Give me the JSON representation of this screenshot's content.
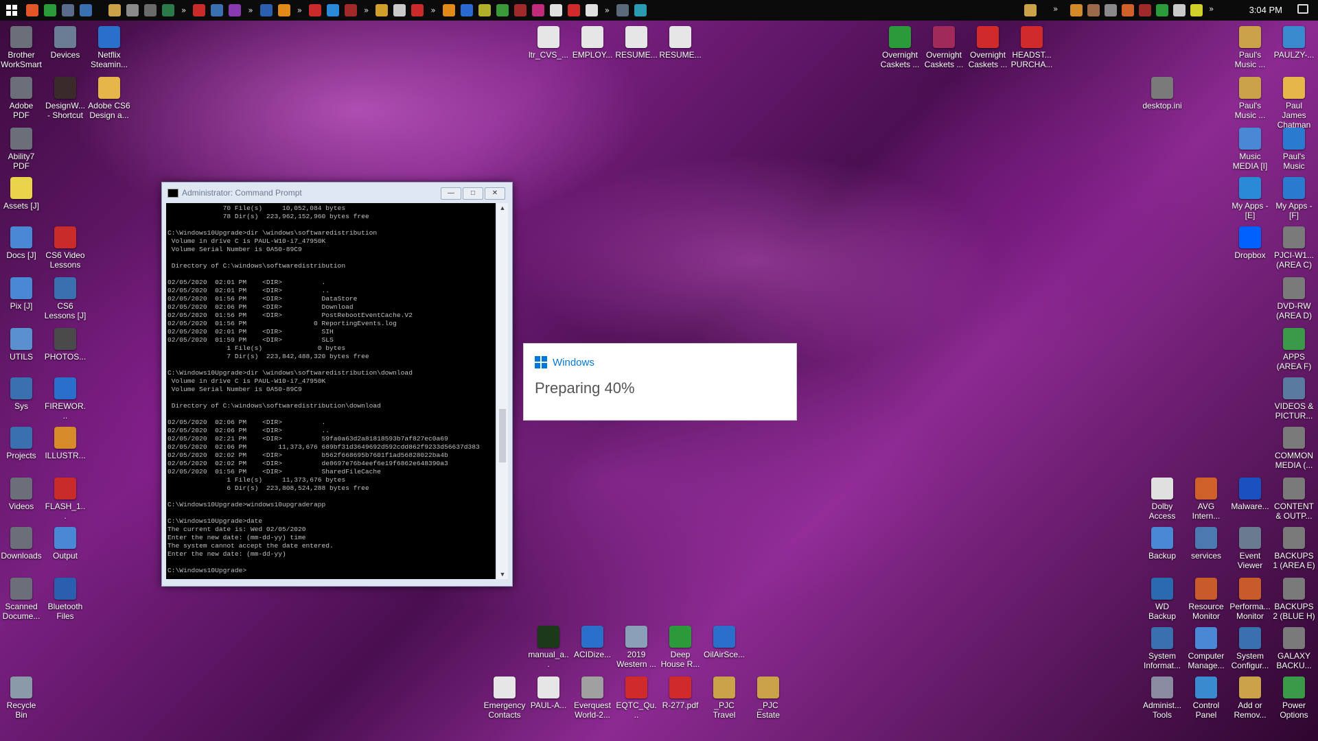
{
  "taskbar": {
    "clock": "3:04 PM",
    "overflow": "»"
  },
  "cmd": {
    "title": "Administrator: Command Prompt",
    "lines": [
      "              70 File(s)     10,052,084 bytes",
      "              78 Dir(s)  223,962,152,960 bytes free",
      "",
      "C:\\Windows10Upgrade>dir \\windows\\softwaredistribution",
      " Volume in drive C is PAUL-W10-i7_47950K",
      " Volume Serial Number is 0A50-89C9",
      "",
      " Directory of C:\\windows\\softwaredistribution",
      "",
      "02/05/2020  02:01 PM    <DIR>          .",
      "02/05/2020  02:01 PM    <DIR>          ..",
      "02/05/2020  01:56 PM    <DIR>          DataStore",
      "02/05/2020  02:06 PM    <DIR>          Download",
      "02/05/2020  01:56 PM    <DIR>          PostRebootEventCache.V2",
      "02/05/2020  01:56 PM                 0 ReportingEvents.log",
      "02/05/2020  02:01 PM    <DIR>          SIH",
      "02/05/2020  01:59 PM    <DIR>          SLS",
      "               1 File(s)              0 bytes",
      "               7 Dir(s)  223,842,488,320 bytes free",
      "",
      "C:\\Windows10Upgrade>dir \\windows\\softwaredistribution\\download",
      " Volume in drive C is PAUL-W10-i7_47950K",
      " Volume Serial Number is 0A50-89C9",
      "",
      " Directory of C:\\windows\\softwaredistribution\\download",
      "",
      "02/05/2020  02:06 PM    <DIR>          .",
      "02/05/2020  02:06 PM    <DIR>          ..",
      "02/05/2020  02:21 PM    <DIR>          59fa0a63d2a81818593b7af827ec0a69",
      "02/05/2020  02:06 PM        11,373,676 689bf31d3649692d592cdd862f9233d56637d383",
      "02/05/2020  02:02 PM    <DIR>          b562f668695b7601f1ad56828022ba4b",
      "02/05/2020  02:02 PM    <DIR>          de8697e76b4eef6e19f6862e648390a3",
      "02/05/2020  01:56 PM    <DIR>          SharedFileCache",
      "               1 File(s)     11,373,676 bytes",
      "               6 Dir(s)  223,808,524,288 bytes free",
      "",
      "C:\\Windows10Upgrade>windows10upgraderapp",
      "",
      "C:\\Windows10Upgrade>date",
      "The current date is: Wed 02/05/2020",
      "Enter the new date: (mm-dd-yy) time",
      "The system cannot accept the date entered.",
      "Enter the new date: (mm-dd-yy)",
      "",
      "C:\\Windows10Upgrade>"
    ]
  },
  "popup": {
    "brand": "Windows",
    "status": "Preparing 40%",
    "progress_percent": 40
  },
  "icons": [
    {
      "label": "Brother WorkSmart",
      "icon": "printer-icon",
      "color": "#6a6f7a"
    },
    {
      "label": "Devices",
      "icon": "devices-icon",
      "color": "#6a7d94"
    },
    {
      "label": "Netflix Steamin...",
      "icon": "tool-icon",
      "color": "#2a6fc9"
    },
    {
      "label": "Adobe PDF",
      "icon": "printer-icon",
      "color": "#6a6f7a"
    },
    {
      "label": "DesignW... - Shortcut",
      "icon": "app-icon",
      "color": "#3b2a2a"
    },
    {
      "label": "Adobe CS6 Design a...",
      "icon": "folder-icon",
      "color": "#e6b64a"
    },
    {
      "label": "Ability7 PDF",
      "icon": "printer-icon",
      "color": "#6a6f7a"
    },
    {
      "label": "Assets [J]",
      "icon": "bulb-icon",
      "color": "#e9d44a"
    },
    {
      "label": "Docs [J]",
      "icon": "docs-icon",
      "color": "#4a88d6"
    },
    {
      "label": "CS6 Video Lessons",
      "icon": "flash-icon",
      "color": "#c92a2a"
    },
    {
      "label": "Pix [J]",
      "icon": "pictures-icon",
      "color": "#4a88d6"
    },
    {
      "label": "CS6 Lessons [J]",
      "icon": "pictures-icon",
      "color": "#3a6fb0"
    },
    {
      "label": "UTILS",
      "icon": "utils-icon",
      "color": "#5a8fd0"
    },
    {
      "label": "PHOTOS...",
      "icon": "camera-icon",
      "color": "#4a4a4a"
    },
    {
      "label": "Sys",
      "icon": "sys-icon",
      "color": "#3a6fb0"
    },
    {
      "label": "FIREWOR...",
      "icon": "app-icon",
      "color": "#2a6fc9"
    },
    {
      "label": "Projects",
      "icon": "projects-icon",
      "color": "#3a6fb0"
    },
    {
      "label": "ILLUSTR...",
      "icon": "illustrator-icon",
      "color": "#d68a2a"
    },
    {
      "label": "Videos",
      "icon": "videos-icon",
      "color": "#6a6f7a"
    },
    {
      "label": "FLASH_1...",
      "icon": "flash-icon",
      "color": "#c92a2a"
    },
    {
      "label": "Downloads",
      "icon": "downloads-icon",
      "color": "#6a6f7a"
    },
    {
      "label": "Output",
      "icon": "output-icon",
      "color": "#4a88d6"
    },
    {
      "label": "Scanned Docume...",
      "icon": "scanner-icon",
      "color": "#6a6f7a"
    },
    {
      "label": "Bluetooth Files",
      "icon": "bluetooth-icon",
      "color": "#2a5fb0"
    },
    {
      "label": "Recycle Bin",
      "icon": "recycle-bin-icon",
      "color": "#8a9aa8"
    },
    {
      "label": "ltr_CVS_...",
      "icon": "document-icon",
      "color": "#e6e6e6"
    },
    {
      "label": "EMPLOY...",
      "icon": "document-icon",
      "color": "#e6e6e6"
    },
    {
      "label": "RESUME...",
      "icon": "document-icon",
      "color": "#e6e6e6"
    },
    {
      "label": "RESUME...",
      "icon": "document-icon",
      "color": "#e6e6e6"
    },
    {
      "label": "Overnight Caskets ...",
      "icon": "chrome-icon",
      "color": "#2a9a3a"
    },
    {
      "label": "Overnight Caskets ...",
      "icon": "winrar-icon",
      "color": "#a02a5a"
    },
    {
      "label": "Overnight Caskets ...",
      "icon": "pdf-icon",
      "color": "#d02a2a"
    },
    {
      "label": "HEADST... PURCHA...",
      "icon": "pdf-icon",
      "color": "#d02a2a"
    },
    {
      "label": "desktop.ini",
      "icon": "settings-file-icon",
      "color": "#7a7a7a"
    },
    {
      "label": "Paul's Music ...",
      "icon": "music-icon",
      "color": "#c9a24a"
    },
    {
      "label": "PAULZY-...",
      "icon": "laptop-icon",
      "color": "#3a8ad0"
    },
    {
      "label": "Paul's Music ...",
      "icon": "music-icon",
      "color": "#c9a24a"
    },
    {
      "label": "Paul James Chatman",
      "icon": "folder-icon",
      "color": "#e6b64a"
    },
    {
      "label": "Music MEDIA [I]",
      "icon": "music-media-icon",
      "color": "#4a88d6"
    },
    {
      "label": "Paul's Music",
      "icon": "music-icon",
      "color": "#2a7ad0"
    },
    {
      "label": "My Apps - [E]",
      "icon": "cloud-icon",
      "color": "#2a8ad8"
    },
    {
      "label": "My Apps - [F]",
      "icon": "info-icon",
      "color": "#2a7ad0"
    },
    {
      "label": "Dropbox",
      "icon": "dropbox-icon",
      "color": "#0061fe"
    },
    {
      "label": "PJCI-W1... (AREA C)",
      "icon": "drive-icon",
      "color": "#7a7a7a"
    },
    {
      "label": "DVD-RW (AREA D)",
      "icon": "dvd-icon",
      "color": "#7a7a7a"
    },
    {
      "label": "APPS (AREA F)",
      "icon": "drive-icon",
      "color": "#3a9a4a"
    },
    {
      "label": "VIDEOS & PICTUR...",
      "icon": "drive-icon",
      "color": "#5a7aa0"
    },
    {
      "label": "COMMON MEDIA (...",
      "icon": "drive-icon",
      "color": "#7a7a7a"
    },
    {
      "label": "Dolby Access",
      "icon": "dolby-icon",
      "color": "#e0e0e0"
    },
    {
      "label": "AVG Intern...",
      "icon": "avg-icon",
      "color": "#d0602a"
    },
    {
      "label": "Malware...",
      "icon": "malwarebytes-icon",
      "color": "#1a50c0"
    },
    {
      "label": "CONTENT & OUTP...",
      "icon": "drive-icon",
      "color": "#7a7a7a"
    },
    {
      "label": "Backup",
      "icon": "backup-icon",
      "color": "#4a88d6"
    },
    {
      "label": "services",
      "icon": "gear-icon",
      "color": "#4a7ab0"
    },
    {
      "label": "Event Viewer",
      "icon": "event-viewer-icon",
      "color": "#6a7a90"
    },
    {
      "label": "BACKUPS 1 (AREA E)",
      "icon": "drive-icon",
      "color": "#7a7a7a"
    },
    {
      "label": "WD Backup",
      "icon": "wd-backup-icon",
      "color": "#2a6ab0"
    },
    {
      "label": "Resource Monitor",
      "icon": "gauge-icon",
      "color": "#c95a2a"
    },
    {
      "label": "Performa... Monitor",
      "icon": "gauge-icon",
      "color": "#c95a2a"
    },
    {
      "label": "BACKUPS 2 (BLUE H)",
      "icon": "drive-icon",
      "color": "#7a7a7a"
    },
    {
      "label": "System Informat...",
      "icon": "system-info-icon",
      "color": "#3a6fb0"
    },
    {
      "label": "Computer Manage...",
      "icon": "computer-management-icon",
      "color": "#4a88d6"
    },
    {
      "label": "System Configur...",
      "icon": "system-config-icon",
      "color": "#3a6fb0"
    },
    {
      "label": "GALAXY BACKU...",
      "icon": "drive-icon",
      "color": "#7a7a7a"
    },
    {
      "label": "Administ... Tools",
      "icon": "admin-tools-icon",
      "color": "#8a8aa0"
    },
    {
      "label": "Control Panel",
      "icon": "control-panel-icon",
      "color": "#3a8ad0"
    },
    {
      "label": "Add or Remov...",
      "icon": "add-remove-icon",
      "color": "#c9a24a"
    },
    {
      "label": "Power Options",
      "icon": "power-icon",
      "color": "#3a9a4a"
    },
    {
      "label": "manual_a...",
      "icon": "terminal-icon",
      "color": "#1a3a1a"
    },
    {
      "label": "ACIDize...",
      "icon": "tool-icon",
      "color": "#2a6fc9"
    },
    {
      "label": "2019 Western ...",
      "icon": "installer-icon",
      "color": "#8aa0b8"
    },
    {
      "label": "Deep House R...",
      "icon": "chrome-icon",
      "color": "#2a9a3a"
    },
    {
      "label": "OilAirSce...",
      "icon": "tool-icon",
      "color": "#2a6fc9"
    },
    {
      "label": "Emergency Contacts",
      "icon": "document-icon",
      "color": "#e6e6e6"
    },
    {
      "label": "PAUL-A...",
      "icon": "document-icon",
      "color": "#e6e6e6"
    },
    {
      "label": "Everquest World-2...",
      "icon": "image-icon",
      "color": "#a0a0a0"
    },
    {
      "label": "EQTC_Qu...",
      "icon": "pdf-icon",
      "color": "#d02a2a"
    },
    {
      "label": "R-277.pdf",
      "icon": "pdf-icon",
      "color": "#d02a2a"
    },
    {
      "label": "_PJC Travel",
      "icon": "winrar-icon",
      "color": "#c9a24a"
    },
    {
      "label": "_PJC Estate",
      "icon": "winrar-icon",
      "color": "#c9a24a"
    }
  ]
}
